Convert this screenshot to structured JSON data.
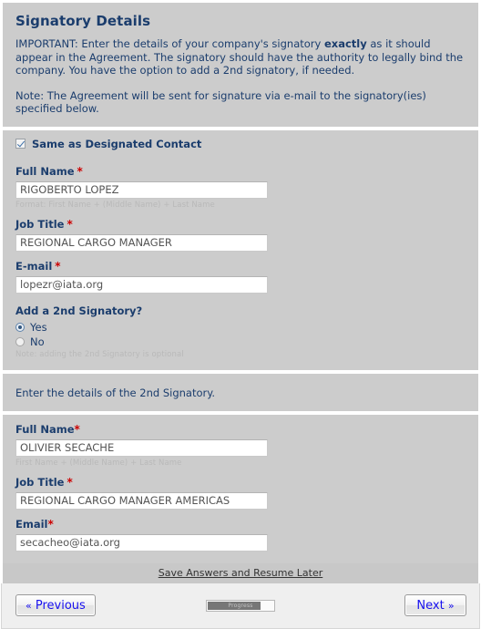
{
  "header": {
    "title": "Signatory Details",
    "intro_line1_prefix": "IMPORTANT: Enter the details of your company's signatory ",
    "intro_line1_emphasis": "exactly",
    "intro_line1_suffix": " as it should appear in the Agreement. The signatory should have the authority to legally bind the company. You have the option to add a 2nd signatory, if needed.",
    "note": "Note: The Agreement will be sent for signature via e-mail to the signatory(ies) specified below."
  },
  "primary_signatory": {
    "same_as_contact_label": "Same as Designated Contact",
    "same_as_contact_checked": true,
    "full_name": {
      "label": "Full Name",
      "required_mark": "*",
      "value": "RIGOBERTO LOPEZ",
      "hint": "Format: First Name + (Middle Name) + Last Name"
    },
    "job_title": {
      "label": "Job Title",
      "required_mark": "*",
      "value": "REGIONAL CARGO MANAGER"
    },
    "email": {
      "label": "E-mail",
      "required_mark": "*",
      "value": "lopezr@iata.org"
    },
    "add_second": {
      "label": "Add a 2nd Signatory?",
      "option_yes": "Yes",
      "option_no": "No",
      "selected": "Yes",
      "note": "Note: adding the 2nd Signatory is optional"
    }
  },
  "second_signatory": {
    "heading": "Enter the details of the 2nd Signatory.",
    "full_name": {
      "label": "Full Name",
      "required_mark": "*",
      "value": "OLIVIER SECACHE",
      "hint": "First Name + (Middle Name) + Last Name"
    },
    "job_title": {
      "label": "Job Title",
      "required_mark": "*",
      "value": "REGIONAL CARGO MANAGER AMERICAS"
    },
    "email": {
      "label": "Email",
      "required_mark": "*",
      "value": "secacheo@iata.org"
    }
  },
  "footer": {
    "save_link": "Save Answers and Resume Later",
    "previous_button": "Previous",
    "previous_chevron": "«",
    "next_button": "Next",
    "next_chevron": "»",
    "progress_label": "Progress",
    "progress_percent": 80
  },
  "colors": {
    "panel_bg": "#cccccc",
    "heading_blue": "#1b3d6d",
    "required_red": "#cc0000",
    "button_text_blue": "#1810ef",
    "footer_bg": "#c8c8c8",
    "nav_bg": "#efefef"
  }
}
